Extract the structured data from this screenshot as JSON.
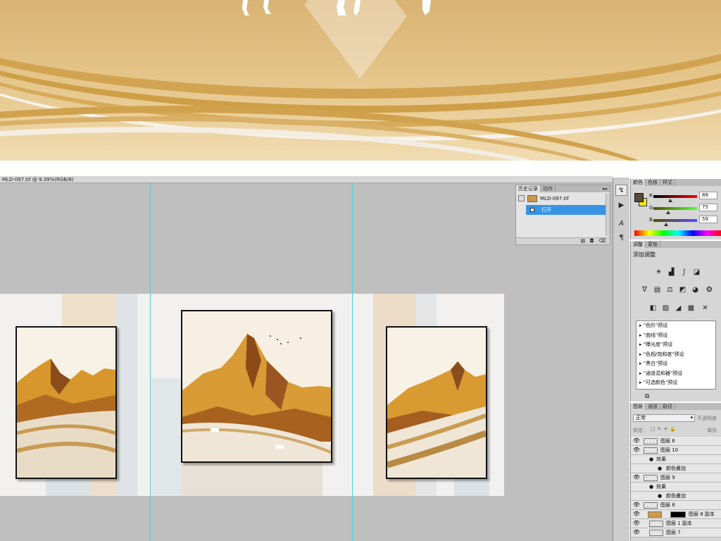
{
  "document": {
    "tab_title": "MLD-097.tif @ 9.39%(RGB/8)"
  },
  "history_panel": {
    "tabs": [
      "历史记录",
      "动作"
    ],
    "snapshot_label": "MLD-097.tif",
    "items": [
      "打开"
    ]
  },
  "color_panel": {
    "tabs": [
      "颜色",
      "色板",
      "样式"
    ],
    "channels": [
      {
        "label": "R",
        "value": "88"
      },
      {
        "label": "G",
        "value": "75"
      },
      {
        "label": "B",
        "value": "59"
      }
    ],
    "foreground": "#584b3b",
    "background": "#f1e21c"
  },
  "adjustments_panel": {
    "tabs": [
      "调整",
      "蒙版"
    ],
    "title": "添加调整",
    "presets": [
      "\"色阶\"预设",
      "\"曲线\"预设",
      "\"曝光度\"预设",
      "\"色相/饱和度\"预设",
      "\"黑白\"预设",
      "\"通道混和器\"预设",
      "\"可选颜色\"预设"
    ]
  },
  "layers_panel": {
    "tabs": [
      "图层",
      "通道",
      "路径"
    ],
    "blend_mode": "正常",
    "opacity_label": "不透明度",
    "lock_label": "锁定:",
    "fill_label": "填充",
    "layers": [
      {
        "name": "图层 6",
        "kind": "layer"
      },
      {
        "name": "图层 10",
        "kind": "layer"
      },
      {
        "name": "效果",
        "kind": "effects"
      },
      {
        "name": "颜色叠加",
        "kind": "effect"
      },
      {
        "name": "图层 9",
        "kind": "layer"
      },
      {
        "name": "效果",
        "kind": "effects"
      },
      {
        "name": "颜色叠加",
        "kind": "effect"
      },
      {
        "name": "图层 8",
        "kind": "layer"
      },
      {
        "name": "图层 8 副本",
        "kind": "masked"
      },
      {
        "name": "图层 1 副本",
        "kind": "layer"
      },
      {
        "name": "图层 7",
        "kind": "layer"
      }
    ]
  }
}
